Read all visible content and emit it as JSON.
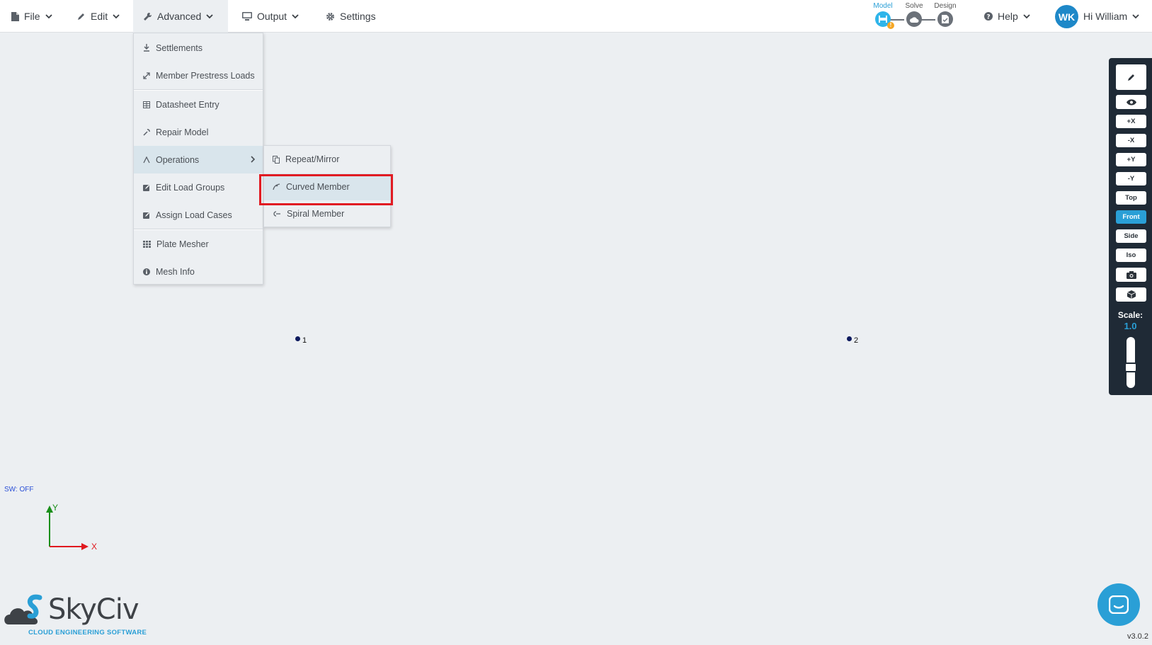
{
  "menubar": {
    "file": "File",
    "edit": "Edit",
    "advanced": "Advanced",
    "output": "Output",
    "settings": "Settings",
    "help": "Help"
  },
  "workflow": {
    "model": "Model",
    "solve": "Solve",
    "design": "Design",
    "warning_mark": "!"
  },
  "user": {
    "initials": "WK",
    "greeting": "Hi William"
  },
  "advanced_menu": {
    "items": [
      {
        "label": "Settlements",
        "icon": "settlement-icon"
      },
      {
        "label": "Member Prestress Loads",
        "icon": "expand-arrows-icon"
      },
      {
        "label": "Datasheet Entry",
        "icon": "table-icon"
      },
      {
        "label": "Repair Model",
        "icon": "wrench-icon"
      },
      {
        "label": "Operations",
        "icon": "caret-up-icon"
      },
      {
        "label": "Edit Load Groups",
        "icon": "edit-box-icon"
      },
      {
        "label": "Assign Load Cases",
        "icon": "edit-box-icon"
      },
      {
        "label": "Plate Mesher",
        "icon": "grid-icon"
      },
      {
        "label": "Mesh Info",
        "icon": "info-icon"
      }
    ]
  },
  "operations_submenu": {
    "items": [
      {
        "label": "Repeat/Mirror",
        "icon": "copy-icon"
      },
      {
        "label": "Curved Member",
        "icon": "curve-icon"
      },
      {
        "label": "Spiral Member",
        "icon": "spiral-icon"
      }
    ]
  },
  "canvas": {
    "node_1": "1",
    "node_2": "2",
    "axis_x": "X",
    "axis_y": "Y",
    "sw_status": "SW: OFF"
  },
  "view_toolbar": {
    "plus_x": "+X",
    "minus_x": "-X",
    "plus_y": "+Y",
    "minus_y": "-Y",
    "top": "Top",
    "front": "Front",
    "side": "Side",
    "iso": "Iso",
    "scale_label": "Scale:",
    "scale_value": "1.0"
  },
  "brand": {
    "name": "SkyCiv",
    "tagline": "CLOUD ENGINEERING SOFTWARE",
    "version": "v3.0.2"
  },
  "colors": {
    "accent": "#2a9fd6",
    "highlight": "#e11b22",
    "toolbar_bg": "#1f2a36"
  }
}
